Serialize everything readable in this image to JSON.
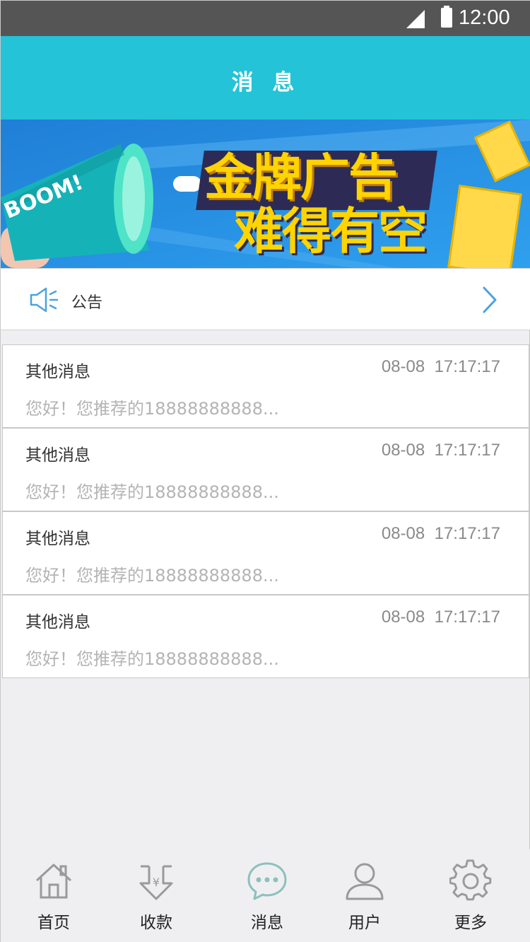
{
  "status_bar": {
    "time": "12:00"
  },
  "header": {
    "title": "消 息"
  },
  "banner": {
    "line1": "金牌广告",
    "line2": "难得有空",
    "megaphone_text": "BOOM!"
  },
  "notice": {
    "label": "公告"
  },
  "messages": [
    {
      "title": "其他消息",
      "time": "08-08  17:17:17",
      "body": "您好！您推荐的18888888888..."
    },
    {
      "title": "其他消息",
      "time": "08-08  17:17:17",
      "body": "您好！您推荐的18888888888..."
    },
    {
      "title": "其他消息",
      "time": "08-08  17:17:17",
      "body": "您好！您推荐的18888888888..."
    },
    {
      "title": "其他消息",
      "time": "08-08  17:17:17",
      "body": "您好！您推荐的18888888888..."
    }
  ],
  "tabbar": {
    "items": [
      {
        "label": "首页",
        "icon": "home-icon"
      },
      {
        "label": "收款",
        "icon": "yen-download-icon"
      },
      {
        "label": "消息",
        "icon": "chat-bubble-icon",
        "active": true
      },
      {
        "label": "用户",
        "icon": "user-icon"
      },
      {
        "label": "更多",
        "icon": "gear-icon"
      }
    ]
  },
  "colors": {
    "accent": "#24c3d7",
    "status_bar": "#555555",
    "background": "#efeff2",
    "banner_yellow": "#ffd400",
    "notice_icon": "#4aa3df"
  }
}
